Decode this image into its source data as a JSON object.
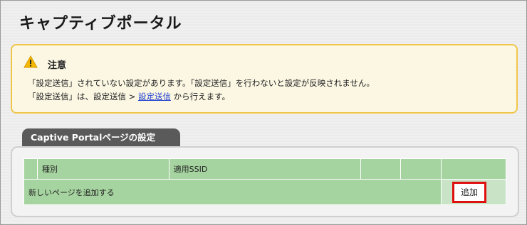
{
  "page": {
    "title": "キャプティブポータル"
  },
  "notice": {
    "icon": "warning-icon",
    "heading": "注意",
    "line1": "「設定送信」されていない設定があります。「設定送信」を行わないと設定が反映されません。",
    "line2_prefix": "「設定送信」は、設定送信 > ",
    "line2_link": "設定送信",
    "line2_suffix": " から行えます。"
  },
  "section": {
    "tab_label": "Captive Portalページの設定",
    "table": {
      "headers": [
        "",
        "種別",
        "適用SSID",
        "",
        "",
        ""
      ],
      "new_row_label": "新しいページを追加する",
      "add_button": "追加"
    }
  },
  "colors": {
    "warning_border": "#f0c64a",
    "table_green": "#a6d4a0",
    "highlight": "#e01010"
  }
}
